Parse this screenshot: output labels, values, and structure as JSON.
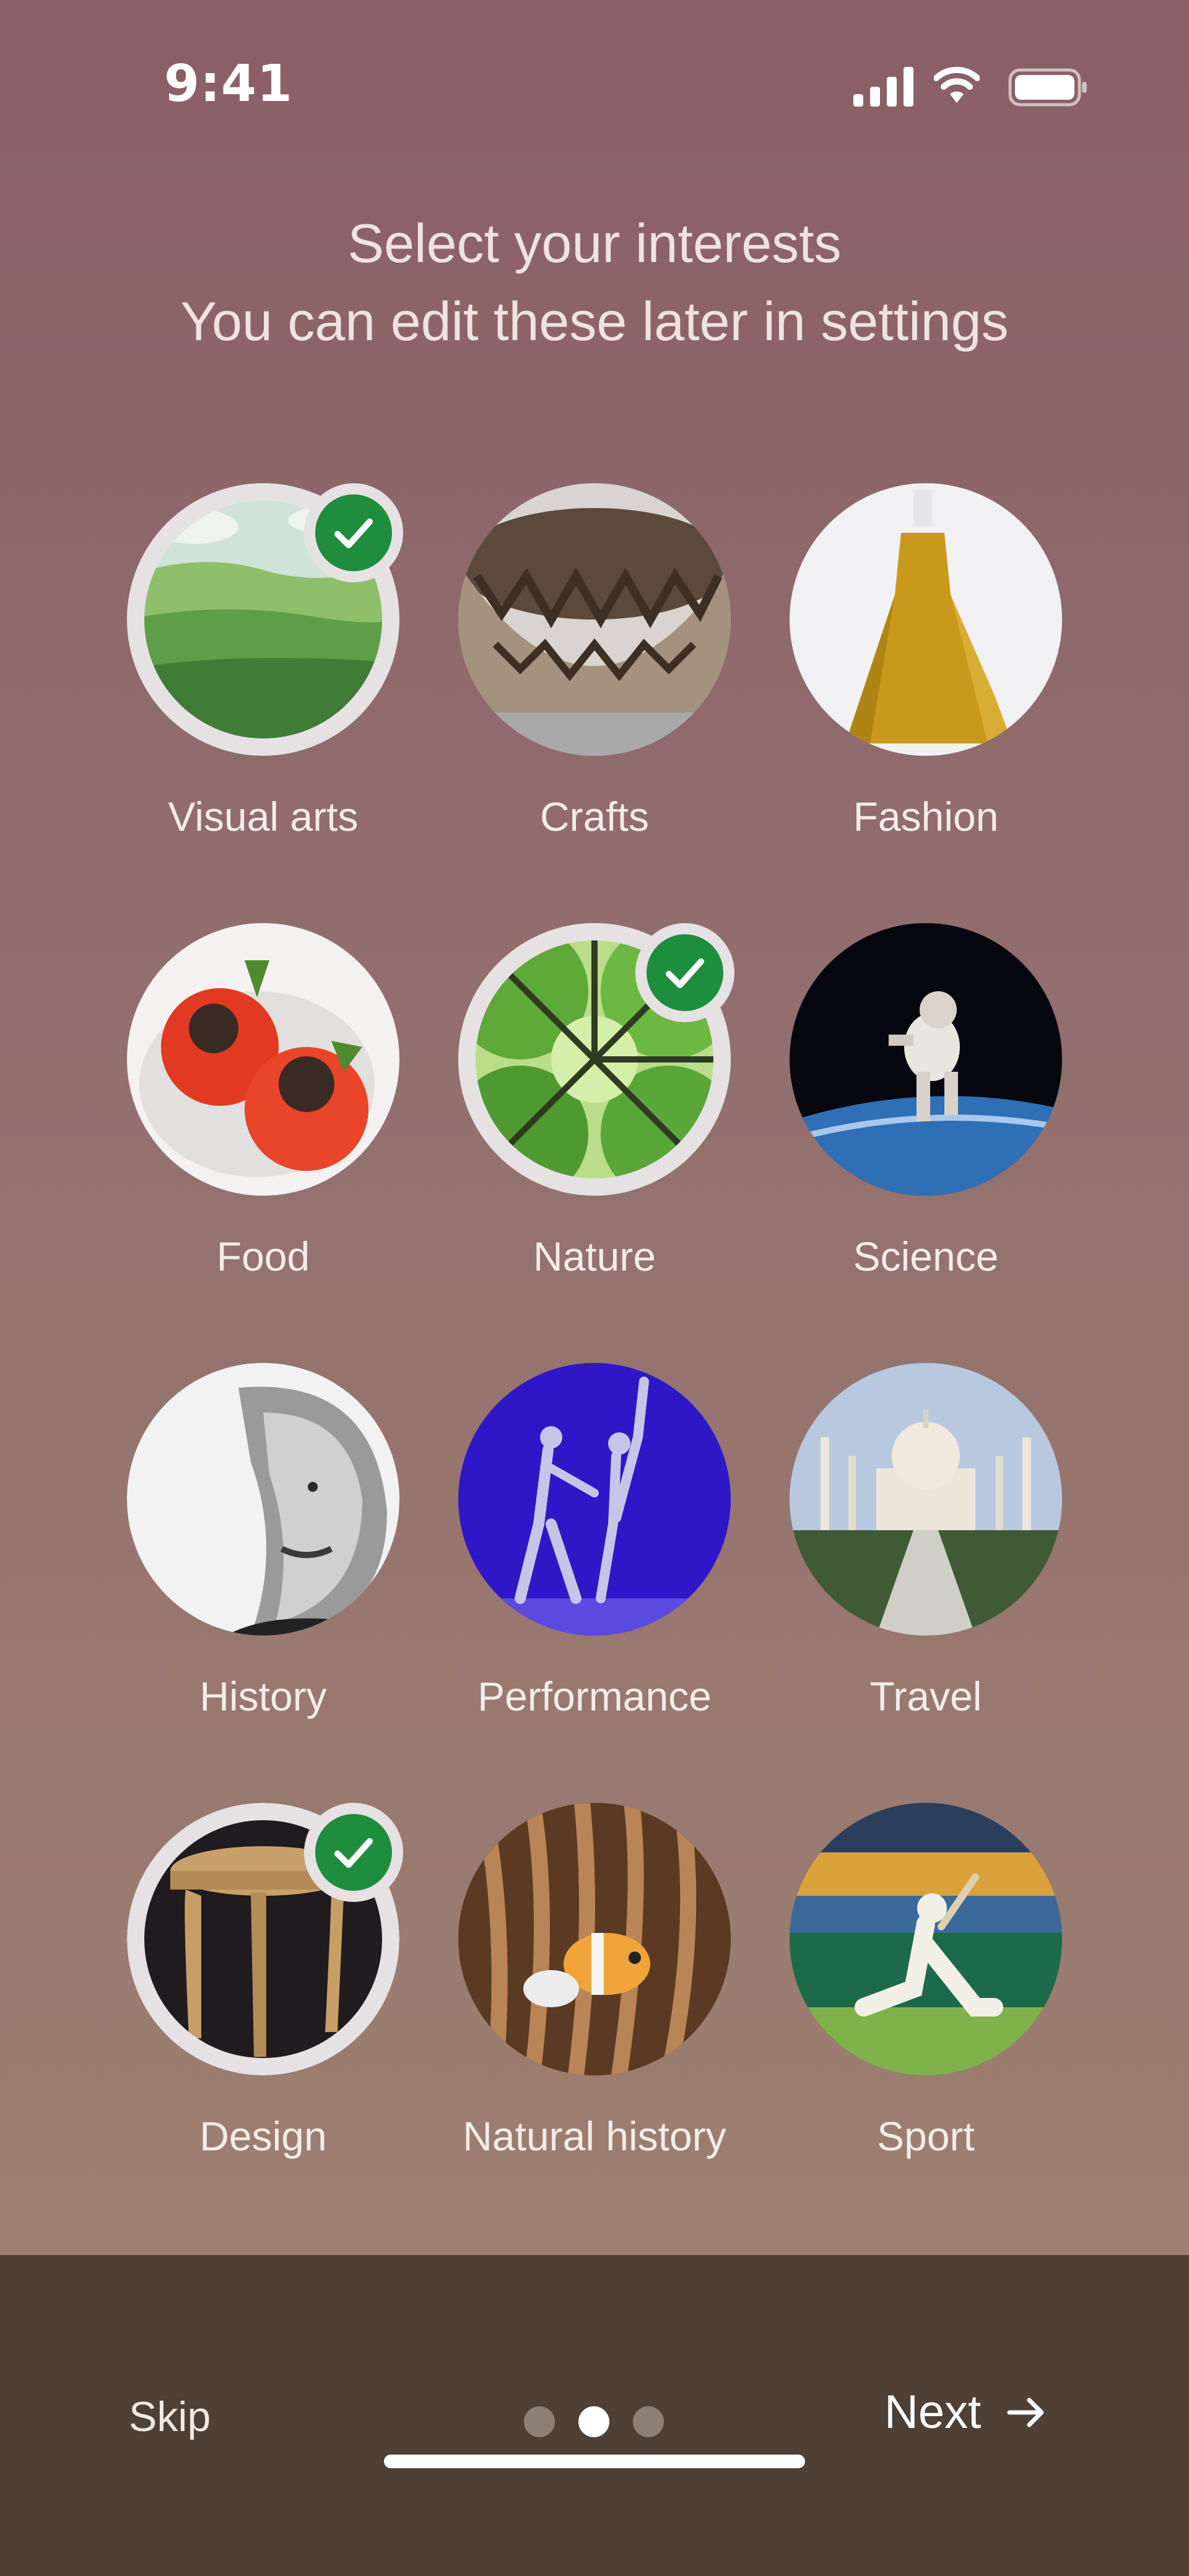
{
  "status_bar": {
    "time": "9:41"
  },
  "header": {
    "title": "Select your interests",
    "subtitle": "You can edit these later in settings"
  },
  "interests": [
    {
      "label": "Visual arts",
      "selected": true,
      "icon": "painting-field"
    },
    {
      "label": "Crafts",
      "selected": false,
      "icon": "carved-bowl"
    },
    {
      "label": "Fashion",
      "selected": false,
      "icon": "yellow-gown"
    },
    {
      "label": "Food",
      "selected": false,
      "icon": "stuffed-tomatoes"
    },
    {
      "label": "Nature",
      "selected": true,
      "icon": "tree-canopy"
    },
    {
      "label": "Science",
      "selected": false,
      "icon": "astronaut"
    },
    {
      "label": "History",
      "selected": false,
      "icon": "portrait-face"
    },
    {
      "label": "Performance",
      "selected": false,
      "icon": "ballet-dancers"
    },
    {
      "label": "Travel",
      "selected": false,
      "icon": "taj-mahal"
    },
    {
      "label": "Design",
      "selected": true,
      "icon": "wooden-stool"
    },
    {
      "label": "Natural history",
      "selected": false,
      "icon": "clownfish-anemone"
    },
    {
      "label": "Sport",
      "selected": false,
      "icon": "cricket-batsman"
    }
  ],
  "footer": {
    "skip_label": "Skip",
    "next_label": "Next",
    "page_count": 3,
    "active_page": 2
  },
  "colors": {
    "check_green": "#1e8e3e",
    "bottom_bar": "#4e4035"
  }
}
